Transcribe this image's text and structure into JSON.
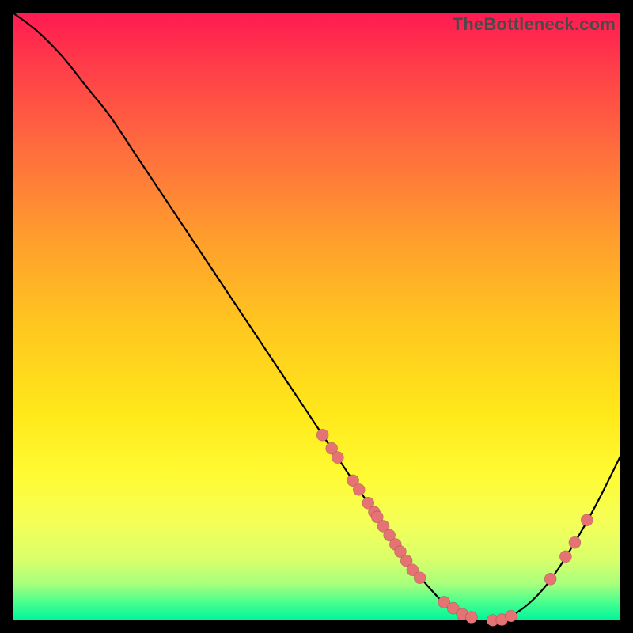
{
  "watermark": "TheBottleneck.com",
  "colors": {
    "background": "#000000",
    "dot": "#e57373",
    "curve": "#000000"
  },
  "chart_data": {
    "type": "line",
    "title": "",
    "xlabel": "",
    "ylabel": "",
    "xlim": [
      0,
      100
    ],
    "ylim": [
      0,
      100
    ],
    "grid": false,
    "series": [
      {
        "name": "bottleneck-curve",
        "x": [
          0,
          4,
          8,
          12,
          16,
          20,
          24,
          28,
          32,
          36,
          40,
          44,
          48,
          52,
          56,
          60,
          64,
          68,
          72,
          76,
          80,
          84,
          88,
          92,
          96,
          100
        ],
        "y": [
          100,
          97,
          93,
          88,
          83,
          77,
          71,
          65,
          59,
          53,
          47,
          41,
          35,
          29,
          23,
          17,
          11,
          6,
          2,
          0,
          0,
          2,
          6,
          12,
          19,
          27
        ]
      }
    ],
    "scatter": [
      {
        "name": "highlight-dots",
        "points": [
          {
            "x": 51,
            "y": 30.5
          },
          {
            "x": 52.5,
            "y": 28.3
          },
          {
            "x": 53.5,
            "y": 26.8
          },
          {
            "x": 56,
            "y": 23.0
          },
          {
            "x": 57,
            "y": 21.5
          },
          {
            "x": 58.5,
            "y": 19.3
          },
          {
            "x": 59.5,
            "y": 17.8
          },
          {
            "x": 60,
            "y": 17.0
          },
          {
            "x": 61,
            "y": 15.5
          },
          {
            "x": 62,
            "y": 14.0
          },
          {
            "x": 63,
            "y": 12.5
          },
          {
            "x": 63.8,
            "y": 11.3
          },
          {
            "x": 64.8,
            "y": 9.8
          },
          {
            "x": 65.8,
            "y": 8.3
          },
          {
            "x": 67,
            "y": 7.0
          },
          {
            "x": 71,
            "y": 3.0
          },
          {
            "x": 72.5,
            "y": 2.0
          },
          {
            "x": 74,
            "y": 1.0
          },
          {
            "x": 75.5,
            "y": 0.5
          },
          {
            "x": 79,
            "y": 0.0
          },
          {
            "x": 80.5,
            "y": 0.1
          },
          {
            "x": 82,
            "y": 0.7
          },
          {
            "x": 88.5,
            "y": 6.8
          },
          {
            "x": 91,
            "y": 10.5
          },
          {
            "x": 92.5,
            "y": 12.8
          },
          {
            "x": 94.5,
            "y": 16.5
          }
        ]
      }
    ]
  }
}
